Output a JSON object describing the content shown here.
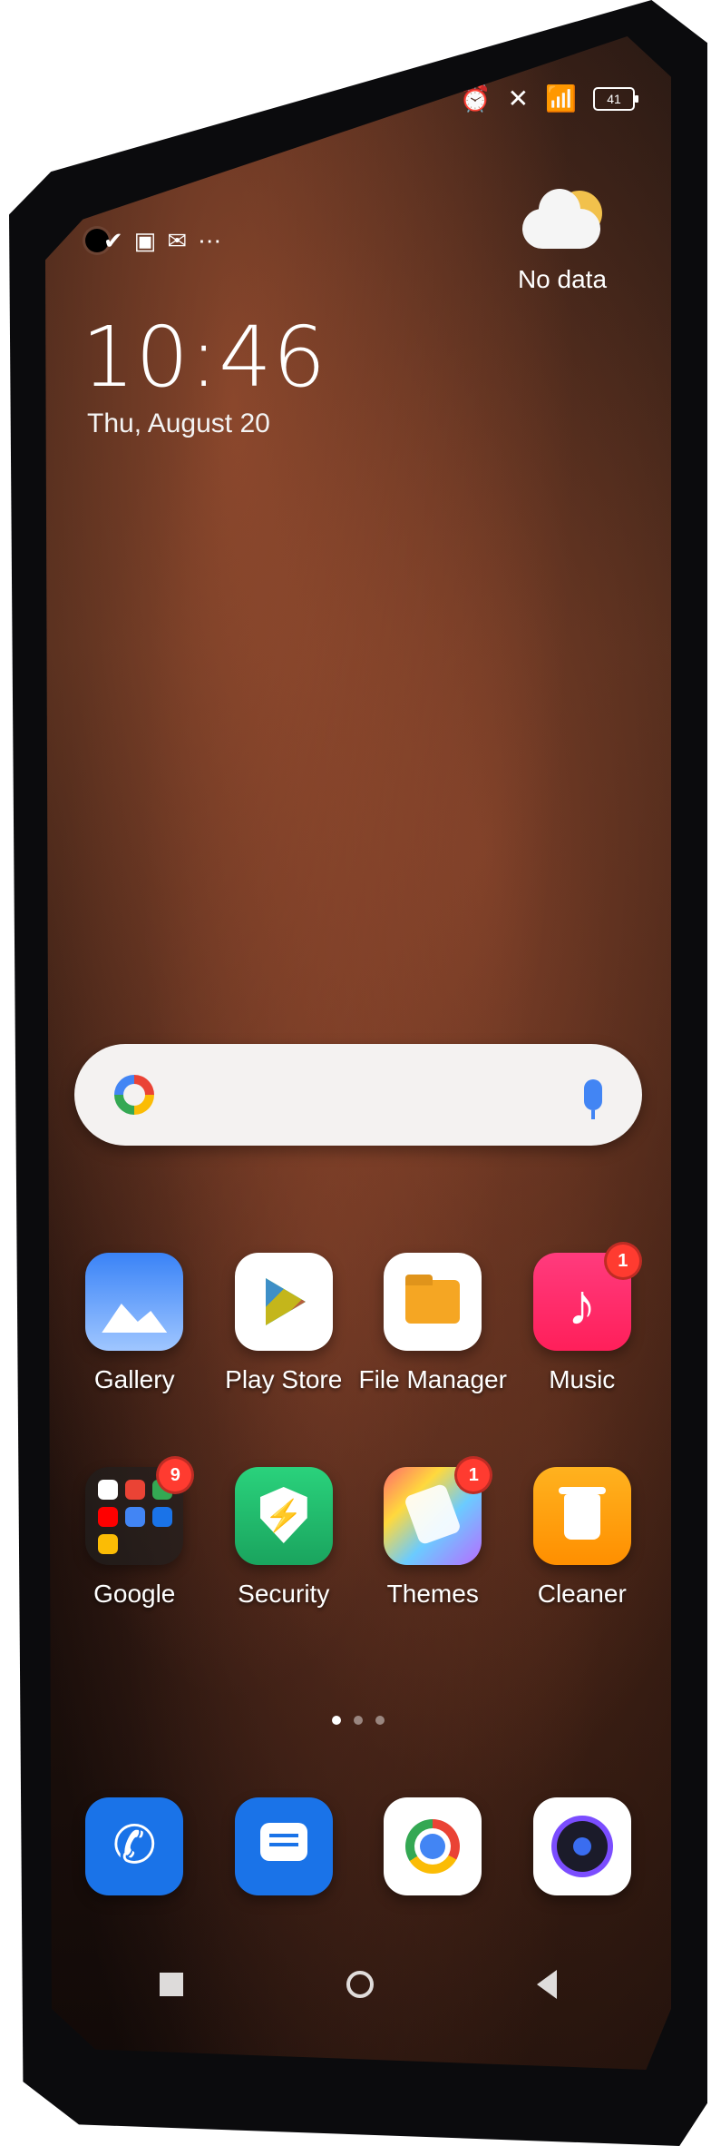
{
  "status": {
    "right_icons": [
      "alarm-icon",
      "sim-icon",
      "wifi-icon"
    ],
    "battery": "41",
    "left_icons": [
      "check-icon",
      "notification-icon",
      "mail-icon",
      "more-icon"
    ]
  },
  "lockscreen": {
    "time": "10:46",
    "date": "Thu, August 20",
    "weather_text": "No data"
  },
  "search": {
    "left_icon": "google-icon",
    "right_icon": "mic-icon"
  },
  "apps": [
    {
      "label": "Gallery",
      "icon": "gallery-icon",
      "badge": ""
    },
    {
      "label": "Play Store",
      "icon": "play-store-icon",
      "badge": ""
    },
    {
      "label": "File Manager",
      "icon": "file-manager-icon",
      "badge": ""
    },
    {
      "label": "Music",
      "icon": "music-icon",
      "badge": "1"
    },
    {
      "label": "Google",
      "icon": "google-folder-icon",
      "badge": "9"
    },
    {
      "label": "Security",
      "icon": "security-icon",
      "badge": ""
    },
    {
      "label": "Themes",
      "icon": "themes-icon",
      "badge": "1"
    },
    {
      "label": "Cleaner",
      "icon": "cleaner-icon",
      "badge": ""
    }
  ],
  "pages": {
    "count": 3,
    "active": 1
  },
  "dock": [
    {
      "icon": "phone-icon"
    },
    {
      "icon": "messages-icon"
    },
    {
      "icon": "chrome-icon"
    },
    {
      "icon": "camera-icon"
    }
  ],
  "nav": [
    "recents-icon",
    "home-icon",
    "back-icon"
  ],
  "colors": {
    "badge": "#ff3b30",
    "search_bg": "#f4f2f1",
    "accent_blue": "#1a73e8"
  }
}
